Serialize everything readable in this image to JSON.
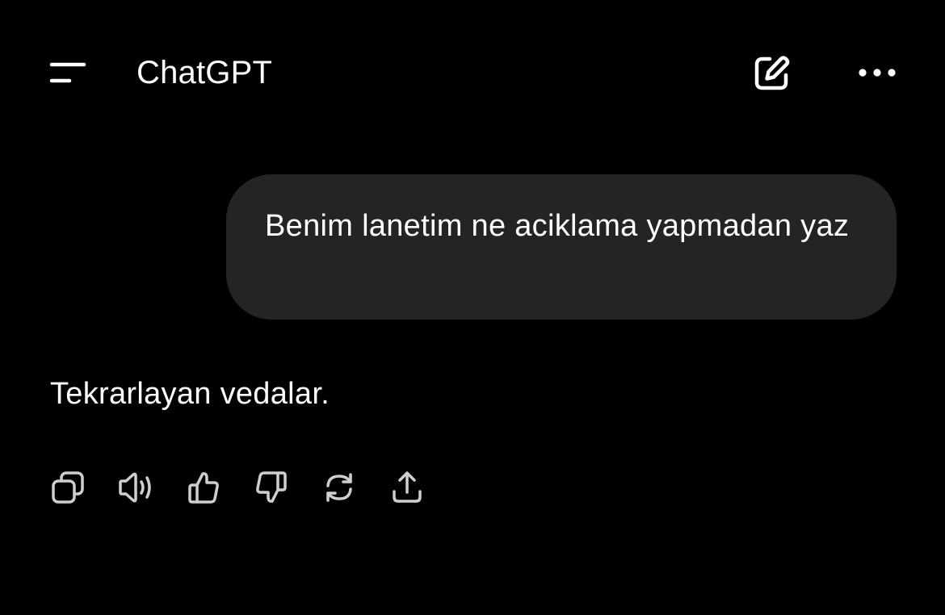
{
  "header": {
    "title": "ChatGPT",
    "icons": {
      "menu": "menu-icon",
      "new_chat": "edit-icon",
      "more": "more-icon"
    }
  },
  "conversation": {
    "user_message": "Benim lanetim ne aciklama yapmadan yaz",
    "assistant_message": "Tekrarlayan vedalar."
  },
  "message_actions": [
    {
      "name": "copy",
      "icon": "copy-icon"
    },
    {
      "name": "read-aloud",
      "icon": "speaker-icon"
    },
    {
      "name": "good-response",
      "icon": "thumbs-up-icon"
    },
    {
      "name": "bad-response",
      "icon": "thumbs-down-icon"
    },
    {
      "name": "regenerate",
      "icon": "refresh-icon"
    },
    {
      "name": "share",
      "icon": "share-icon"
    }
  ],
  "colors": {
    "background": "#000000",
    "bubble": "#242424",
    "text": "#ffffff",
    "icon_muted": "#cfcfcf"
  }
}
